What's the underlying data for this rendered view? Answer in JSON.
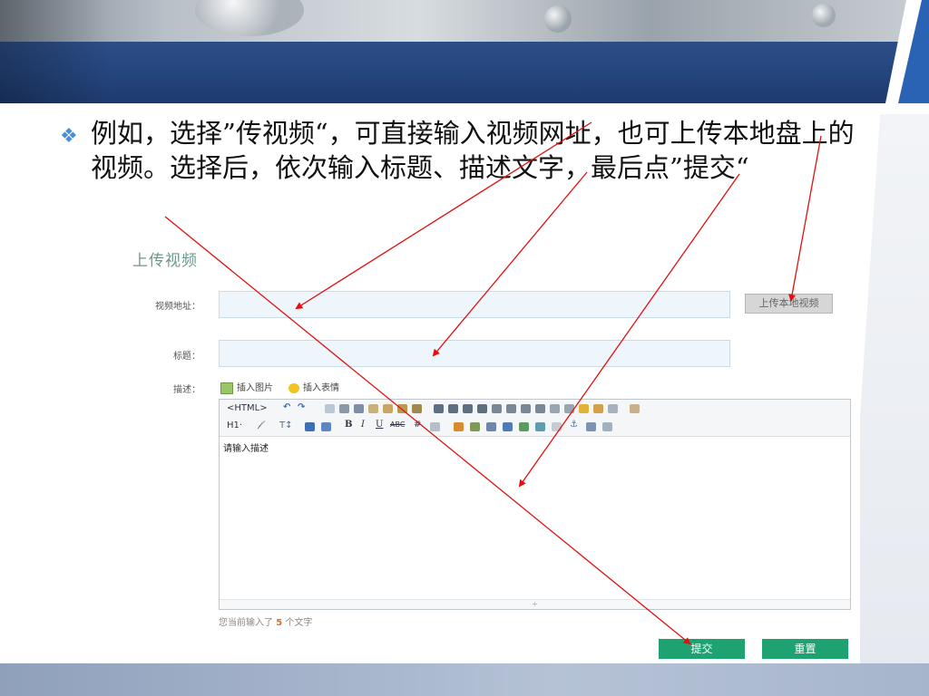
{
  "slide": {
    "bullet_text": "例如，选择”传视频“，可直接输入视频网址，也可上传本地盘上的视频。选择后，依次输入标题、描述文字，最后点”提交“"
  },
  "form": {
    "title": "上传视频",
    "video_url_label": "视频地址：",
    "video_url_value": "",
    "upload_local_label": "上传本地视频",
    "title_label": "标题：",
    "title_value": "",
    "description_label": "描述：",
    "insert_image_label": "插入图片",
    "insert_emoji_label": "插入表情",
    "editor": {
      "toolbar_row1": [
        "<HTML>",
        "↶",
        "↷",
        "B",
        "I",
        "U"
      ],
      "html_label": "<HTML>",
      "h1_label": "H1·",
      "placeholder_text": "请输入描述",
      "resize_glyph": "÷"
    },
    "char_count_prefix": "您当前输入了",
    "char_count": "5",
    "char_count_suffix": "个文字",
    "submit_label": "提交",
    "reset_label": "重置"
  },
  "colors": {
    "header_blue": "#24447c",
    "accent_green": "#1fa271",
    "annotation_red": "#e01010",
    "input_bg": "#eef6fb"
  }
}
